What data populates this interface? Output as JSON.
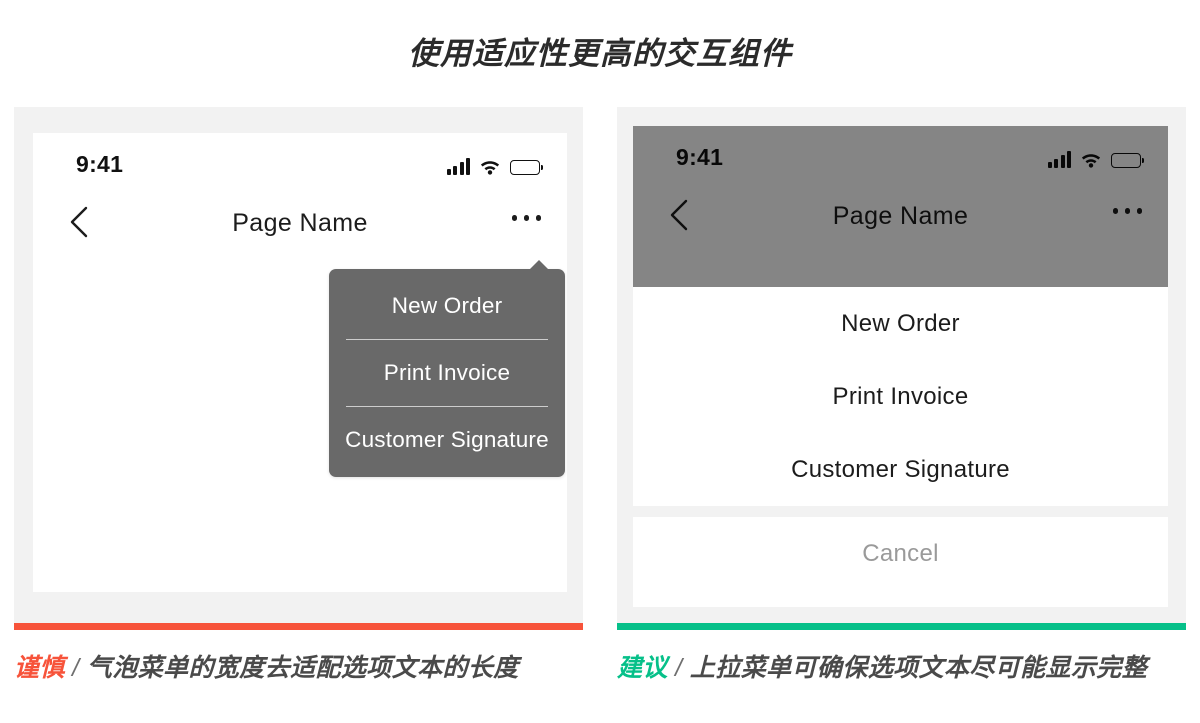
{
  "title": "使用适应性更高的交互组件",
  "colors": {
    "bad_accent": "#f7533a",
    "good_accent": "#06c089",
    "card_bg": "#f2f2f2",
    "popover_bg": "#696969",
    "screen_bg": "#ffffff"
  },
  "status_bar": {
    "time": "9:41",
    "signal_icon": "signal-bars-icon",
    "wifi_icon": "wifi-icon",
    "battery_icon": "battery-full-icon"
  },
  "nav_bar": {
    "back_icon": "chevron-left-icon",
    "title": "Page Name",
    "more_icon": "more-horizontal-icon"
  },
  "left_example": {
    "popover": {
      "items": [
        {
          "label": "New Order"
        },
        {
          "label": "Print Invoice"
        },
        {
          "label": "Customer Signature"
        }
      ]
    },
    "caption": {
      "tag": "谨慎",
      "separator": "/",
      "text": "气泡菜单的宽度去适配选项文本的长度"
    }
  },
  "right_example": {
    "action_sheet": {
      "items": [
        {
          "label": "New Order"
        },
        {
          "label": "Print Invoice"
        },
        {
          "label": "Customer Signature"
        }
      ],
      "cancel_label": "Cancel"
    },
    "caption": {
      "tag": "建议",
      "separator": "/",
      "text": "上拉菜单可确保选项文本尽可能显示完整"
    }
  }
}
